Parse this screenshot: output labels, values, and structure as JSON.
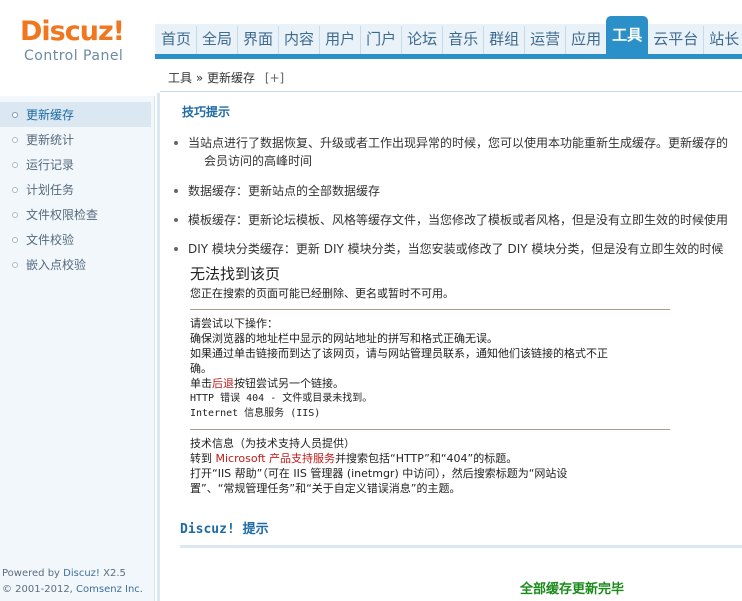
{
  "logo": {
    "brand": "Discuz!",
    "subtitle": "Control Panel"
  },
  "nav": {
    "tabs": [
      {
        "label": "首页",
        "active": false
      },
      {
        "label": "全局",
        "active": false
      },
      {
        "label": "界面",
        "active": false
      },
      {
        "label": "内容",
        "active": false
      },
      {
        "label": "用户",
        "active": false
      },
      {
        "label": "门户",
        "active": false
      },
      {
        "label": "论坛",
        "active": false
      },
      {
        "label": "音乐",
        "active": false
      },
      {
        "label": "群组",
        "active": false
      },
      {
        "label": "运营",
        "active": false
      },
      {
        "label": "应用",
        "active": false
      },
      {
        "label": "工具",
        "active": true
      },
      {
        "label": "云平台",
        "active": false
      },
      {
        "label": "站长",
        "active": false
      },
      {
        "label": "›",
        "active": false
      }
    ]
  },
  "breadcrumb": {
    "path": "工具 » 更新缓存",
    "add": "[+]"
  },
  "sidebar": {
    "items": [
      {
        "label": "更新缓存",
        "active": true
      },
      {
        "label": "更新统计",
        "active": false
      },
      {
        "label": "运行记录",
        "active": false
      },
      {
        "label": "计划任务",
        "active": false
      },
      {
        "label": "文件权限检查",
        "active": false
      },
      {
        "label": "文件校验",
        "active": false
      },
      {
        "label": "嵌入点校验",
        "active": false
      }
    ],
    "powered_prefix": "Powered by ",
    "powered_name": "Discuz!",
    "powered_version": " X2.5",
    "copyright": "© 2001-2012, ",
    "copyright_company": "Comsenz Inc."
  },
  "tips": {
    "title": "技巧提示",
    "items": [
      "当站点进行了数据恢复、升级或者工作出现异常的时候，您可以使用本功能重新生成缓存。更新缓存的",
      "会员访问的高峰时间",
      "数据缓存：更新站点的全部数据缓存",
      "模板缓存：更新论坛模板、风格等缓存文件，当您修改了模板或者风格，但是没有立即生效的时候使用",
      "DIY 模块分类缓存：更新 DIY 模块分类，当您安装或修改了 DIY 模块分类，但是没有立即生效的时候"
    ]
  },
  "error_page": {
    "title": "无法找到该页",
    "subtitle": "您正在搜索的页面可能已经删除、更名或暂时不可用。",
    "try_heading": "请尝试以下操作：",
    "line1": "确保浏览器的地址栏中显示的网站地址的拼写和格式正确无误。",
    "line2a": "如果通过单击链接而到达了该网页，请与网站管理员联系，通知他们该链接的格式不正",
    "line2b": "确。",
    "line3_pre": "单击",
    "line3_link": "后退",
    "line3_post": "按钮尝试另一个链接。",
    "http_error": "HTTP 错误 404 - 文件或目录未找到。",
    "iis": "Internet 信息服务 (IIS)",
    "tech_heading": "技术信息（为技术支持人员提供）",
    "tech1_pre": "转到 ",
    "tech1_link": "Microsoft 产品支持服务",
    "tech1_post": "并搜索包括“HTTP”和“404”的标题。",
    "tech2a": "打开“IIS 帮助”（可在 IIS 管理器 (inetmgr) 中访问），然后搜索标题为“网站设",
    "tech2b": "置”、“常规管理任务”和“关于自定义错误消息”的主题。"
  },
  "discuz_tip": {
    "title": "Discuz! 提示",
    "message": "全部缓存更新完毕"
  },
  "colors": {
    "accent": "#2b8fc8",
    "brand_orange": "#f0761f",
    "success_green": "#1a8a1a",
    "link_red": "#c01a1a"
  }
}
